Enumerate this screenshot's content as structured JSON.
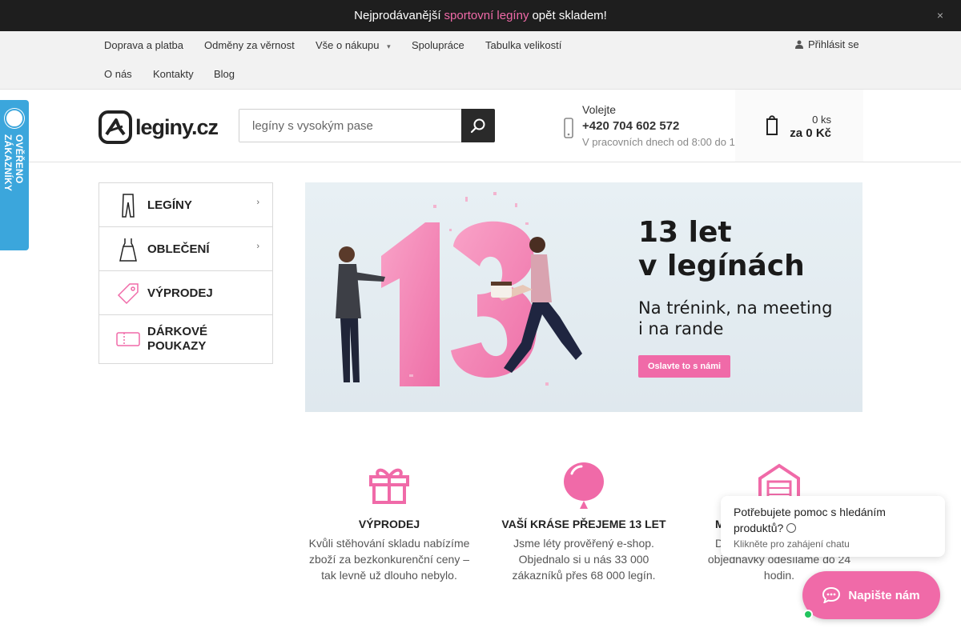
{
  "announcement": {
    "before": "Nejprodávanější",
    "highlight": "sportovní legíny",
    "after": "opět skladem!",
    "close": "×"
  },
  "topnav": {
    "items": [
      "Doprava a platba",
      "Odměny za věrnost",
      "Vše o nákupu",
      "Spolupráce",
      "Tabulka velikostí",
      "O nás",
      "Kontakty",
      "Blog"
    ],
    "dropdown_indicator": "▾",
    "login": "Přihlásit se"
  },
  "header": {
    "logo_text": "leginy.cz",
    "search_placeholder": "legíny s vysokým pase",
    "call_label": "Volejte",
    "call_number": "+420 704 602 572",
    "call_hours": "V pracovních dnech od 8:00 do 1",
    "cart_count": "0 ks",
    "cart_total": "za 0 Kč"
  },
  "badge": {
    "text": "OVĚŘENO ZÁKAZNÍKY"
  },
  "categories": [
    {
      "label": "LEGÍNY",
      "has_submenu": true
    },
    {
      "label": "OBLEČENÍ",
      "has_submenu": true
    },
    {
      "label": "VÝPRODEJ",
      "has_submenu": false
    },
    {
      "label": "DÁRKOVÉ POUKAZY",
      "has_submenu": false
    }
  ],
  "banner": {
    "number": "13",
    "headline_line1": "13 let",
    "headline_line2": "v legínách",
    "sub_line1": "Na trénink, na meeting",
    "sub_line2": "i na rande",
    "cta": "Oslavte to s námi"
  },
  "features": [
    {
      "icon": "gift-icon",
      "title": "VÝPRODEJ",
      "desc": "Kvůli stěhování skladu nabízíme zboží za bezkonkurenční ceny – tak levně už dlouho nebylo."
    },
    {
      "icon": "balloon-icon",
      "title": "VAŠÍ KRÁSE PŘEJEME 13 LET",
      "desc": "Jsme léty prověřený e-shop. Objednalo si u nás 33 000 zákazníků přes 68 000 legín."
    },
    {
      "icon": "warehouse-icon",
      "title": "M",
      "desc_line1": "D",
      "desc_line2": "objednávky odesíláme do 24",
      "desc_line3": "hodin."
    }
  ],
  "chat": {
    "question": "Potřebujete pomoc s hledáním produktů? ",
    "hint": "Klikněte pro zahájení chatu",
    "button": "Napište nám"
  },
  "colors": {
    "brand_pink": "#f06aa8",
    "dark": "#1e1e1e",
    "badge_blue": "#3ba6dc",
    "online_green": "#21c45d"
  }
}
